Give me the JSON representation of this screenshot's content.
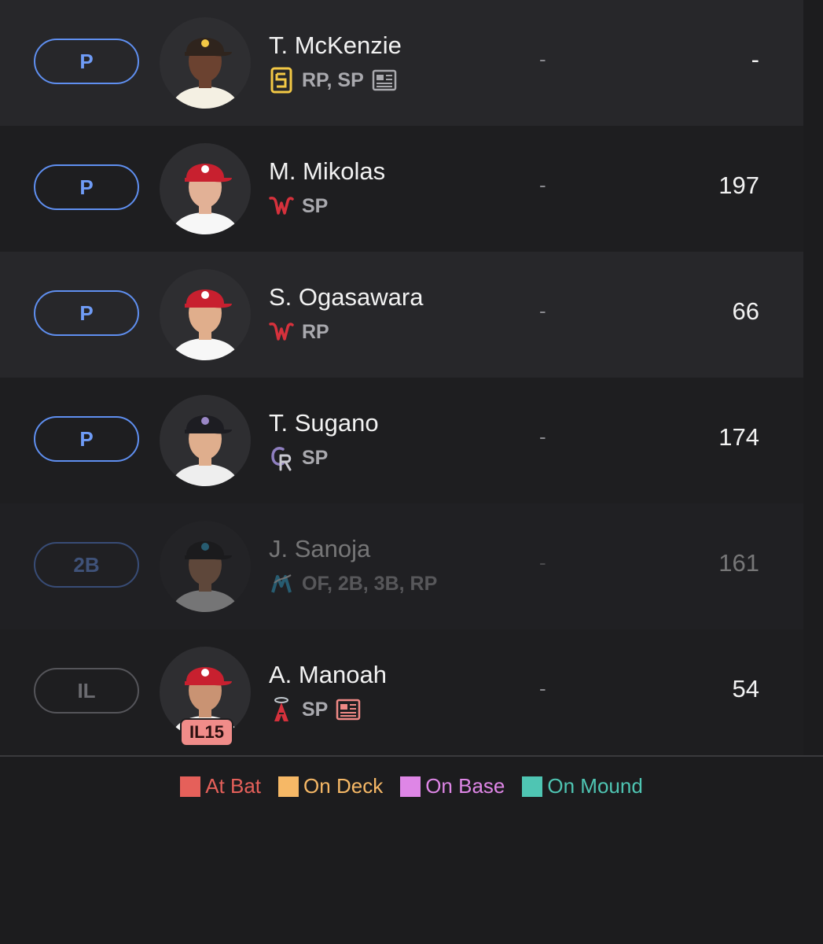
{
  "players": [
    {
      "slot": "P",
      "slot_type": "active",
      "name": "T. McKenzie",
      "team_icon": "padres-logo",
      "positions": "RP, SP",
      "has_news": true,
      "middle_stat": "-",
      "value": "-",
      "cap_color": "#2f241d",
      "cap_logo_color": "#f3c845",
      "jersey_color": "#f4f0e3",
      "skin_color": "#6b4230",
      "dimmed": false
    },
    {
      "slot": "P",
      "slot_type": "active",
      "name": "M. Mikolas",
      "team_icon": "nationals-logo",
      "positions": "SP",
      "has_news": false,
      "middle_stat": "-",
      "value": "197",
      "cap_color": "#c8202f",
      "cap_logo_color": "#ffffff",
      "jersey_color": "#f7f7f7",
      "skin_color": "#e2b196",
      "dimmed": false
    },
    {
      "slot": "P",
      "slot_type": "active",
      "name": "S. Ogasawara",
      "team_icon": "nationals-logo",
      "positions": "RP",
      "has_news": false,
      "middle_stat": "-",
      "value": "66",
      "cap_color": "#c8202f",
      "cap_logo_color": "#ffffff",
      "jersey_color": "#f7f7f7",
      "skin_color": "#e0ae8c",
      "dimmed": false
    },
    {
      "slot": "P",
      "slot_type": "active",
      "name": "T. Sugano",
      "team_icon": "rockies-logo",
      "positions": "SP",
      "has_news": false,
      "middle_stat": "-",
      "value": "174",
      "cap_color": "#1d1d22",
      "cap_logo_color": "#9a87c6",
      "jersey_color": "#eeeeee",
      "skin_color": "#dfae8d",
      "dimmed": false
    },
    {
      "slot": "2B",
      "slot_type": "active",
      "name": "J. Sanoja",
      "team_icon": "marlins-logo",
      "positions": "OF, 2B, 3B, RP",
      "has_news": false,
      "middle_stat": "-",
      "value": "161",
      "cap_color": "#1a1a1c",
      "cap_logo_color": "#37b6e3",
      "jersey_color": "#efefef",
      "skin_color": "#b98462",
      "dimmed": true
    },
    {
      "slot": "IL",
      "slot_type": "il",
      "name": "A. Manoah",
      "team_icon": "angels-logo",
      "positions": "SP",
      "has_news": true,
      "middle_stat": "-",
      "value": "54",
      "cap_color": "#c8202f",
      "cap_logo_color": "#ffffff",
      "jersey_color": "#f5f5f5",
      "skin_color": "#c99373",
      "dimmed": false,
      "injury_badge": "IL15"
    }
  ],
  "legend": [
    {
      "label": "At Bat",
      "color": "#e5605a"
    },
    {
      "label": "On Deck",
      "color": "#f6b866"
    },
    {
      "label": "On Base",
      "color": "#de86e6"
    },
    {
      "label": "On Mound",
      "color": "#4fc5b3"
    }
  ],
  "colors": {
    "slot_border": "#5f8ff0",
    "slot_text": "#6f9cf7",
    "news_icon_default": "#a9a9ae",
    "news_icon_alert": "#ef8985"
  }
}
